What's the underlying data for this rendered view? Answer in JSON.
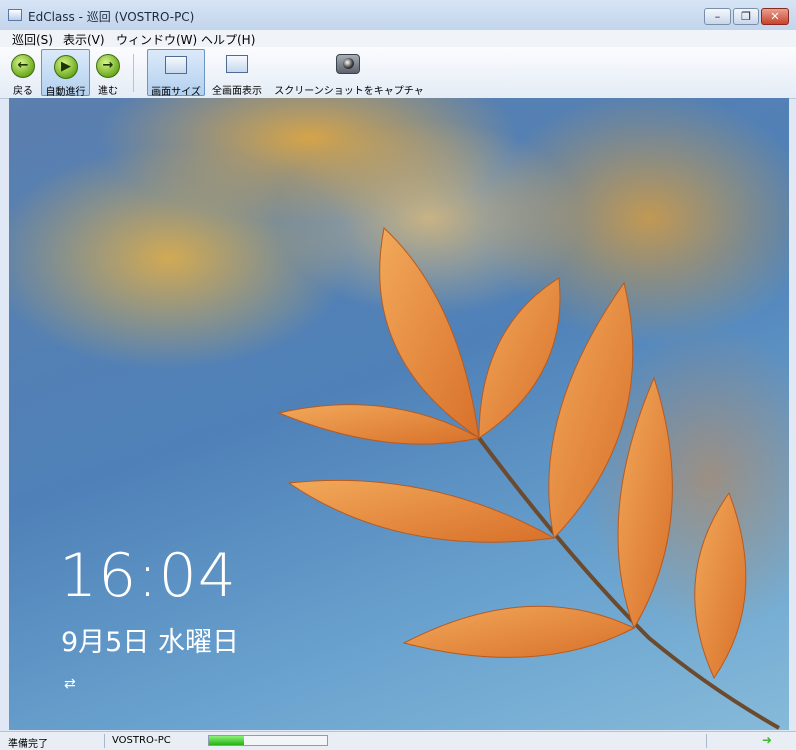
{
  "window": {
    "title": "EdClass - 巡回 (VOSTRO-PC)",
    "min_glyph": "–",
    "max_glyph": "❐",
    "close_glyph": "✕"
  },
  "menu": {
    "items": [
      "巡回(S)",
      "表示(V)",
      "ウィンドウ(W)",
      "ヘルプ(H)"
    ]
  },
  "toolbar": {
    "back_label": "戻る",
    "auto_label": "自動進行",
    "forward_label": "進む",
    "screen_size_label": "画面サイズ",
    "fullscreen_label": "全画面表示",
    "capture_label": "スクリーンショットをキャプチャ",
    "back_glyph": "←",
    "auto_glyph": "▶",
    "forward_glyph": "→"
  },
  "lockscreen": {
    "time": "16:04",
    "date": "9月5日 水曜日",
    "network_glyph": "⇄"
  },
  "status": {
    "ready": "準備完了",
    "pc_name": "VOSTRO-PC",
    "progress": 0.3,
    "arrow_glyph": "➜"
  },
  "colors": {
    "accent": "#25b312",
    "leaf": "#e48a3c"
  }
}
